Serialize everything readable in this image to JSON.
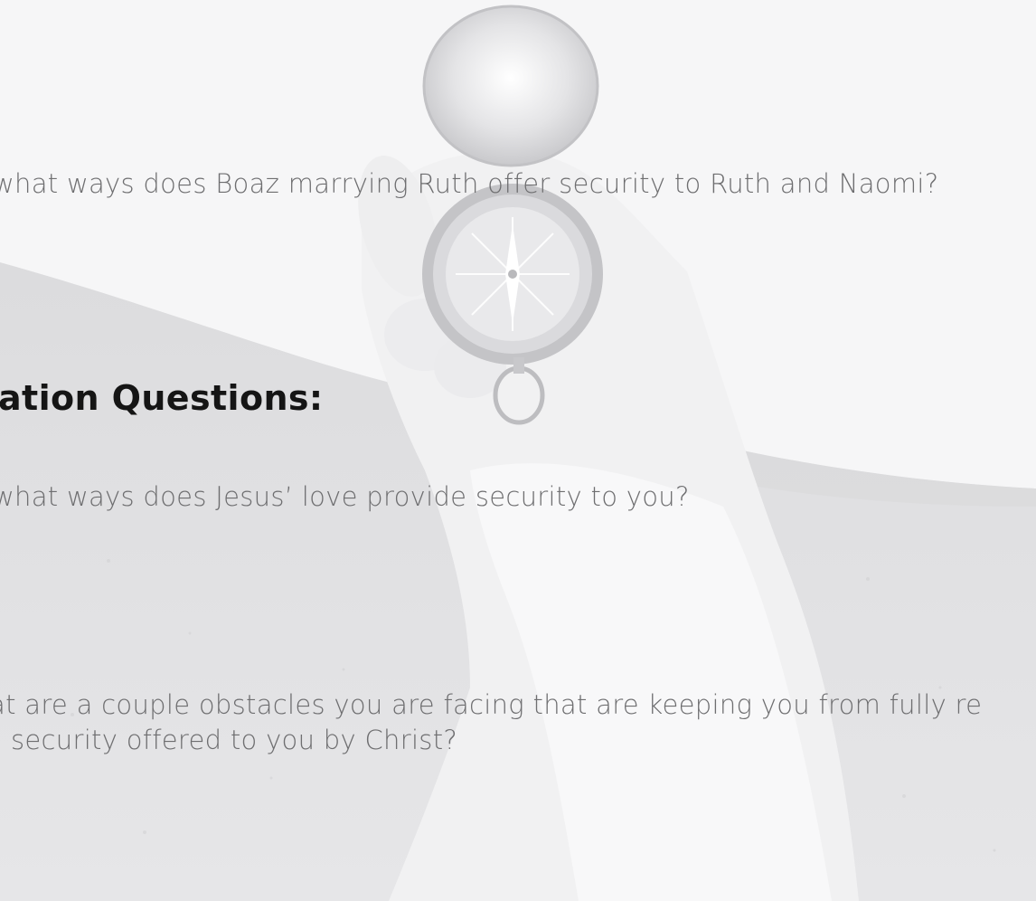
{
  "background": {
    "image_subject": "hand-holding-compass-photo",
    "tint": "#f2f2f3"
  },
  "questions": {
    "q1": "what ways does Boaz marrying Ruth offer security to Ruth and Naomi?",
    "q2": "what ways does Jesus’ love provide security to you?",
    "q3_line1": "at are a couple obstacles you are facing that are keeping you from fully re",
    "q3_line2": "security offered to you by Christ?"
  },
  "section": {
    "heading": "ation Questions:"
  },
  "colors": {
    "question_text": "#6e6e70",
    "heading_text": "#151515"
  }
}
